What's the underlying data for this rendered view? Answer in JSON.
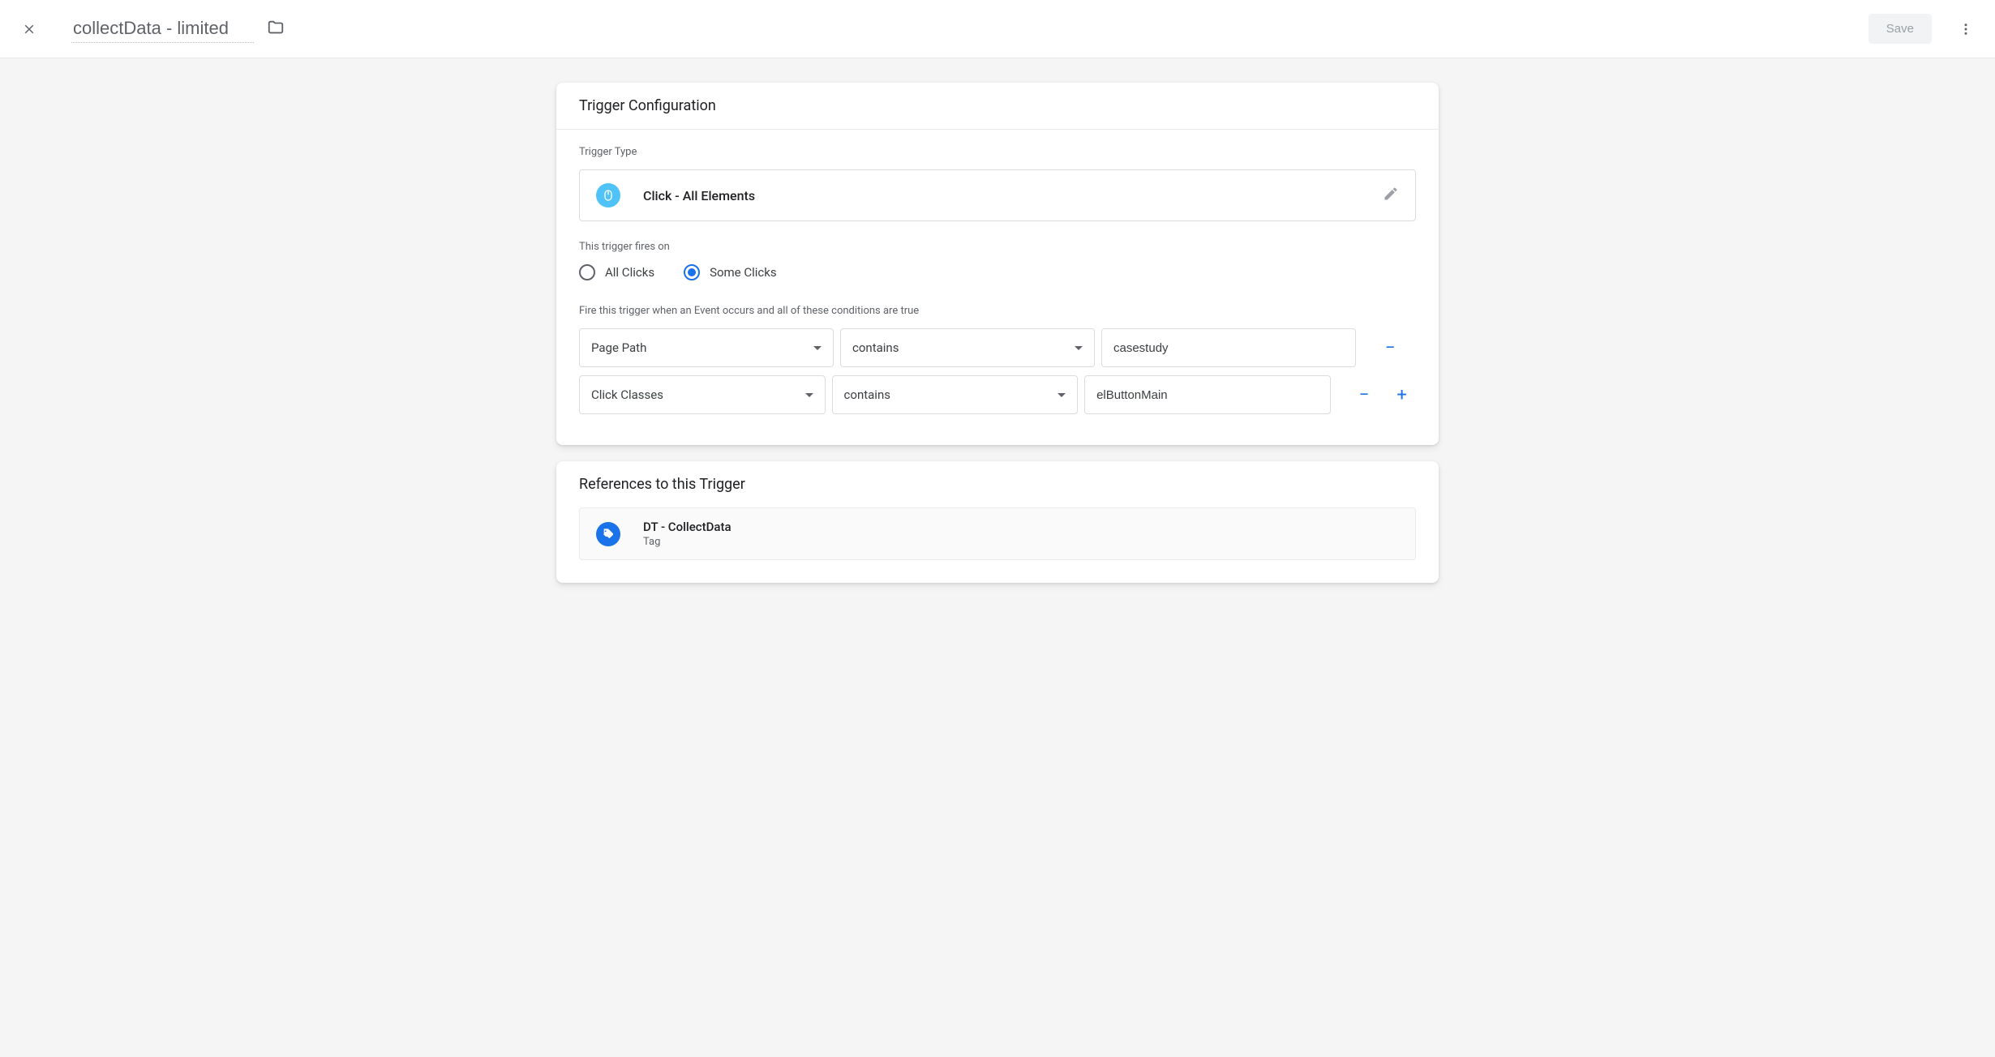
{
  "header": {
    "title": "collectData - limited",
    "save_label": "Save"
  },
  "config": {
    "card_title": "Trigger Configuration",
    "trigger_type_label": "Trigger Type",
    "trigger_type_value": "Click - All Elements",
    "fires_on_label": "This trigger fires on",
    "radio_all": "All Clicks",
    "radio_some": "Some Clicks",
    "conditions_label": "Fire this trigger when an Event occurs and all of these conditions are true",
    "conditions": [
      {
        "variable": "Page Path",
        "operator": "contains",
        "value": "casestudy"
      },
      {
        "variable": "Click Classes",
        "operator": "contains",
        "value": "elButtonMain"
      }
    ]
  },
  "references": {
    "card_title": "References to this Trigger",
    "items": [
      {
        "title": "DT - CollectData",
        "subtitle": "Tag"
      }
    ]
  }
}
